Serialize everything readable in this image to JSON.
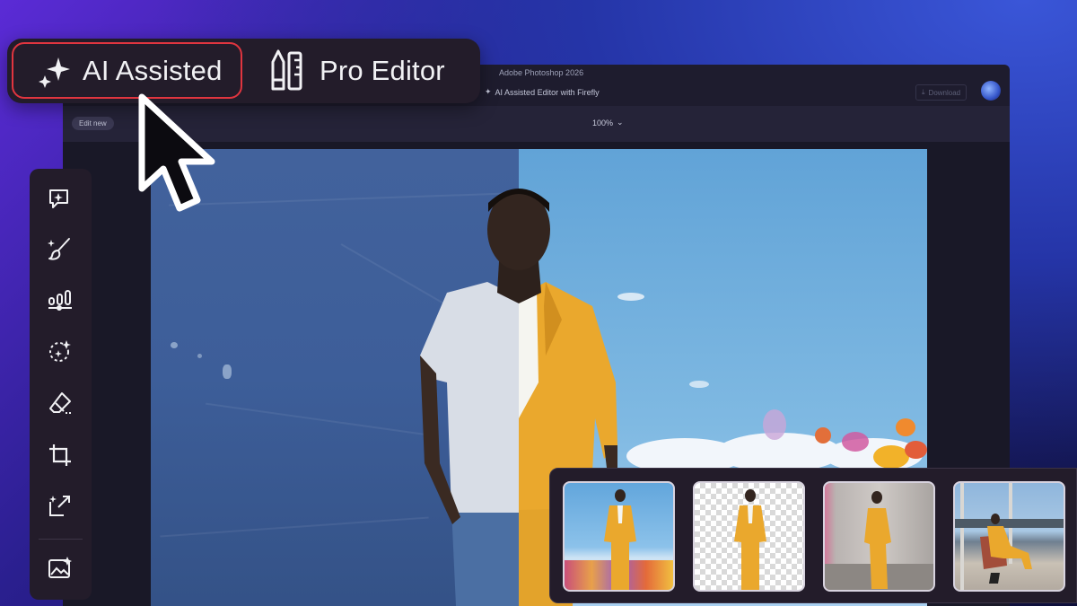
{
  "app": {
    "title": "Adobe Photoshop 2026",
    "subtitle": "AI Assisted Editor with Firefly",
    "download_label": "Download",
    "edit_new_label": "Edit new",
    "zoom_label": "100%"
  },
  "mode_switch": {
    "ai_label": "AI Assisted",
    "pro_label": "Pro Editor",
    "active": "AI Assisted"
  },
  "toolbar": {
    "tools": [
      {
        "icon": "ai-chat-sparkle-icon"
      },
      {
        "icon": "brush-icon"
      },
      {
        "icon": "adjustments-icon"
      },
      {
        "icon": "magic-select-icon"
      },
      {
        "icon": "eraser-icon"
      },
      {
        "icon": "crop-icon"
      },
      {
        "icon": "expand-icon"
      },
      {
        "icon": "image-generate-icon"
      }
    ]
  },
  "thumbnails": [
    {
      "name": "flower-field-variant"
    },
    {
      "name": "transparent-background-variant"
    },
    {
      "name": "concrete-room-variant"
    },
    {
      "name": "window-interior-variant"
    }
  ],
  "colors": {
    "accent_red": "#e0353f",
    "panel": "#231c2a",
    "suit_yellow": "#e8a92c"
  }
}
